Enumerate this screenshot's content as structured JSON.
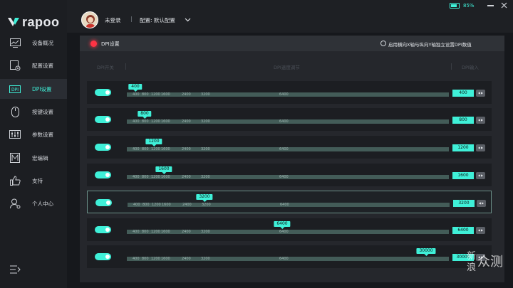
{
  "brand": {
    "logo_text": "rapoo"
  },
  "colors": {
    "accent": "#3ff0d8",
    "record": "#ff3344",
    "track": "#435c58"
  },
  "sidebar": {
    "items": [
      {
        "label": "设备概况",
        "icon": "monitor-chart-icon"
      },
      {
        "label": "配置设置",
        "icon": "config-gear-icon"
      },
      {
        "label": "DPI设置",
        "icon": "dpi-icon",
        "active": true
      },
      {
        "label": "按键设置",
        "icon": "mouse-icon"
      },
      {
        "label": "参数设置",
        "icon": "sliders-icon"
      },
      {
        "label": "宏编辑",
        "icon": "macro-icon"
      },
      {
        "label": "支持",
        "icon": "thumbs-up-icon"
      },
      {
        "label": "个人中心",
        "icon": "user-settings-icon"
      }
    ]
  },
  "header": {
    "login_status": "未登录",
    "separator": "|",
    "config_label": "配置: 默认配置",
    "battery_percent": "85%"
  },
  "dpi_section": {
    "title": "DPI设置",
    "xy_option": "启用横向X轴与纵向Y轴独立设置DPI数值",
    "columns": {
      "toggle": "DPI开关",
      "slider": "DPI速度调节",
      "input": "DPI输入"
    },
    "ticks": [
      "400",
      "800",
      "1200",
      "1600",
      "2400",
      "3200",
      "6400"
    ],
    "dpi_max": 30000,
    "rows": [
      {
        "value": "400",
        "dpi": 400,
        "enabled": true,
        "selected": false
      },
      {
        "value": "800",
        "dpi": 800,
        "enabled": true,
        "selected": false
      },
      {
        "value": "1200",
        "dpi": 1200,
        "enabled": true,
        "selected": false
      },
      {
        "value": "1600",
        "dpi": 1600,
        "enabled": true,
        "selected": false
      },
      {
        "value": "3200",
        "dpi": 3200,
        "enabled": true,
        "selected": true
      },
      {
        "value": "6400",
        "dpi": 6400,
        "enabled": true,
        "selected": false
      },
      {
        "value": "30000",
        "dpi": 30000,
        "enabled": true,
        "selected": false
      }
    ]
  },
  "watermark": {
    "line1": "新",
    "line2": "浪",
    "line3": "众测"
  }
}
